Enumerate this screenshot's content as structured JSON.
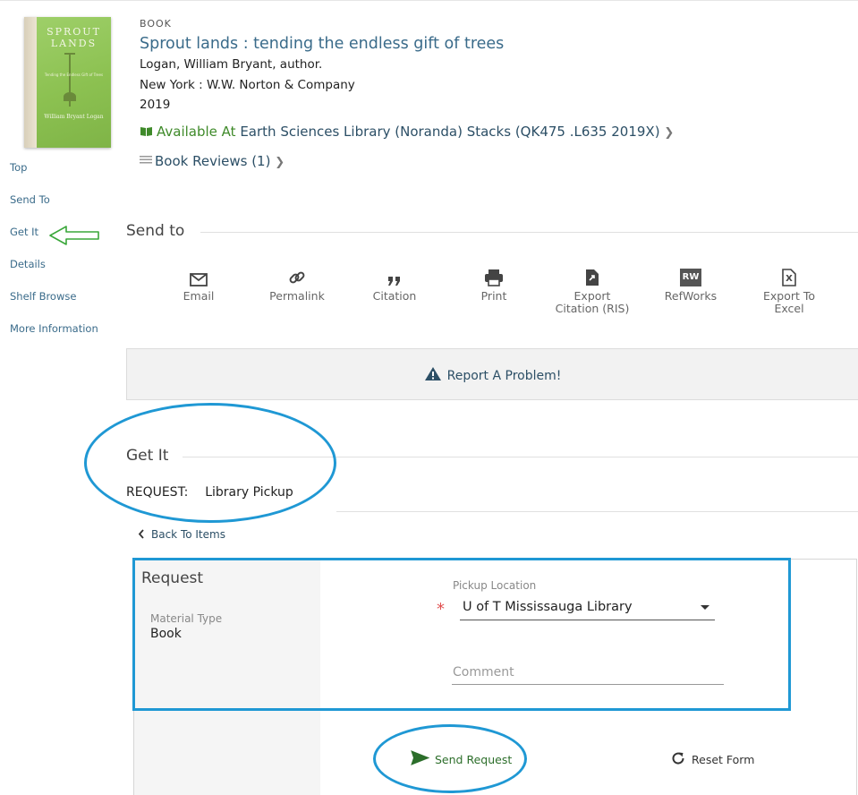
{
  "record": {
    "format": "BOOK",
    "title": "Sprout lands : tending the endless gift of trees",
    "author": "Logan, William Bryant, author.",
    "publisher": "New York : W.W. Norton & Company",
    "year": "2019",
    "availability_status": "Available At",
    "availability_location": "Earth Sciences Library (Noranda)  Stacks (QK475 .L635 2019X)",
    "reviews_label": "Book Reviews (1)"
  },
  "cover": {
    "title": "SPROUT LANDS",
    "subtitle": "Tending the Endless Gift of Trees",
    "author": "William Bryant Logan"
  },
  "sidebar": {
    "items": [
      {
        "label": "Top"
      },
      {
        "label": "Send To"
      },
      {
        "label": "Get It"
      },
      {
        "label": "Details"
      },
      {
        "label": "Shelf Browse"
      },
      {
        "label": "More Information"
      }
    ]
  },
  "send_to": {
    "heading": "Send to",
    "actions": [
      {
        "label": "Email",
        "icon": "email-icon"
      },
      {
        "label": "Permalink",
        "icon": "link-icon"
      },
      {
        "label": "Citation",
        "icon": "quote-icon"
      },
      {
        "label": "Print",
        "icon": "print-icon"
      },
      {
        "label": "Export Citation (RIS)",
        "icon": "export-icon"
      },
      {
        "label": "RefWorks",
        "icon": "refworks-icon",
        "icon_text": "RW"
      },
      {
        "label": "Export To Excel",
        "icon": "excel-icon",
        "icon_text": "X"
      }
    ],
    "report_problem": "Report A Problem!"
  },
  "get_it": {
    "heading": "Get It",
    "request_label": "REQUEST:",
    "request_type": "Library Pickup",
    "back_label": "Back To Items"
  },
  "form": {
    "heading": "Request",
    "material_type_label": "Material Type",
    "material_type_value": "Book",
    "pickup_label": "Pickup Location",
    "pickup_value": "U of T Mississauga Library",
    "required_mark": "*",
    "comment_placeholder": "Comment",
    "send_label": "Send Request",
    "reset_label": "Reset Form"
  },
  "colors": {
    "link": "#3a6b8a",
    "available_green": "#3f8a2a",
    "annotation_blue": "#1f98d4",
    "annotation_green": "#3aa73a"
  }
}
